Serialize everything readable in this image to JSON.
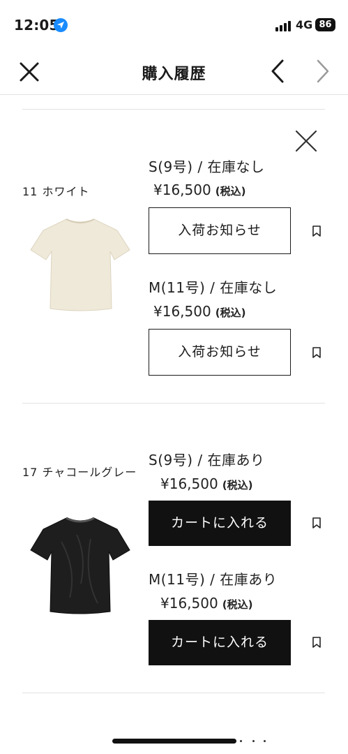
{
  "status_bar": {
    "time": "12:05",
    "network": "4G",
    "battery": "86"
  },
  "header": {
    "title": "購入履歴"
  },
  "products": [
    {
      "color": "11 ホワイト",
      "image": "tshirt-ivory",
      "image_color": "#efe9d9",
      "variants": [
        {
          "size": "S(9号) / 在庫なし",
          "price": "¥16,500",
          "tax": "(税込)",
          "button": "入荷お知らせ"
        },
        {
          "size": "M(11号) / 在庫なし",
          "price": "¥16,500",
          "tax": "(税込)",
          "button": "入荷お知らせ"
        }
      ]
    },
    {
      "color": "17 チャコールグレー",
      "image": "tshirt-charcoal-velvet",
      "image_color": "#1e1e1e",
      "variants": [
        {
          "size": "S(9号) / 在庫あり",
          "price": "¥16,500",
          "tax": "(税込)",
          "button": "カートに入れる"
        },
        {
          "size": "M(11号) / 在庫あり",
          "price": "¥16,500",
          "tax": "(税込)",
          "button": "カートに入れる"
        }
      ]
    }
  ],
  "icons": {
    "close": "close-icon",
    "prev": "chevron-left-icon",
    "next": "chevron-right-icon",
    "remove": "close-icon",
    "bookmark": "bookmark-icon"
  },
  "colors": {
    "primary_button": "#111111",
    "disabled_chevron": "#9a9a9a",
    "location_accent": "#1a8cff",
    "divider": "#e2e2e2"
  }
}
